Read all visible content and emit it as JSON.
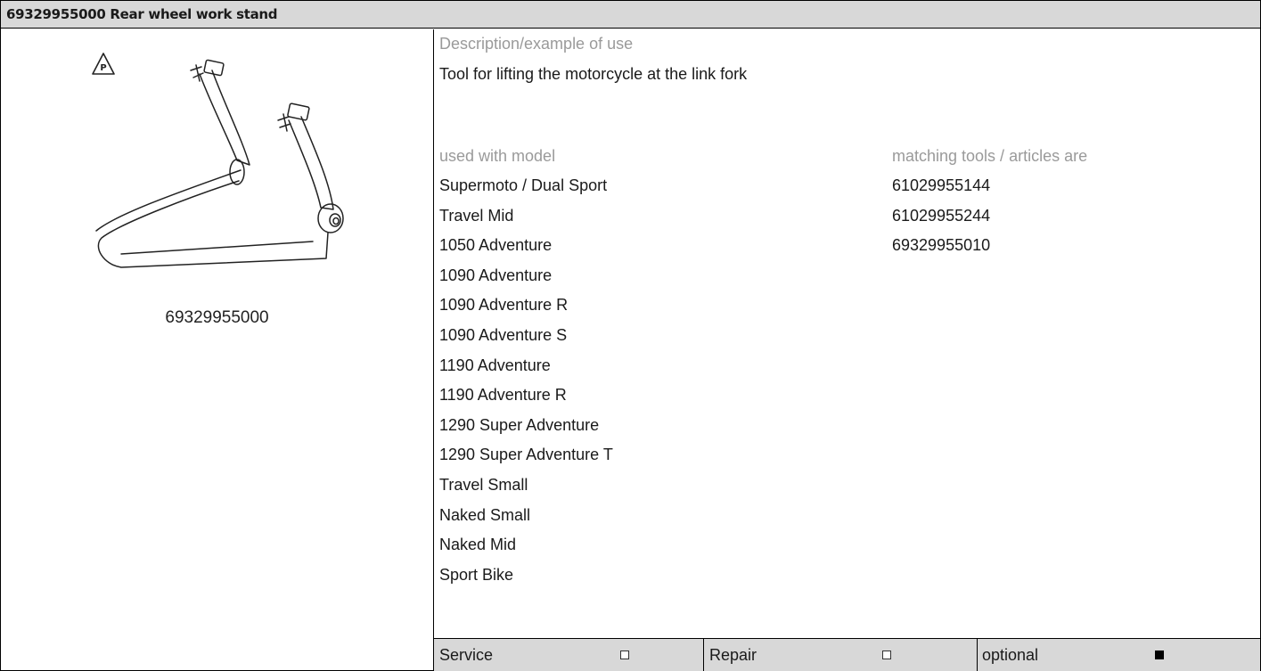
{
  "header": {
    "title": "69329955000 Rear wheel work stand"
  },
  "tool": {
    "image_icon": "rear-wheel-work-stand-drawing",
    "warning_icon": "p-warning-triangle-icon",
    "warning_letter": "P",
    "number": "69329955000"
  },
  "description": {
    "label": "Description/example of use",
    "text": "Tool for lifting the motorcycle at the link fork"
  },
  "models": {
    "label": "used with model",
    "items": [
      "Supermoto / Dual Sport",
      "Travel Mid",
      "1050 Adventure",
      "1090 Adventure",
      "1090 Adventure R",
      "1090 Adventure S",
      "1190 Adventure",
      "1190 Adventure R",
      "1290 Super Adventure",
      "1290 Super Adventure T",
      "Travel Small",
      "Naked Small",
      "Naked Mid",
      "Sport Bike"
    ]
  },
  "matching": {
    "label": "matching tools / articles are",
    "items": [
      "61029955144",
      "61029955244",
      "69329955010"
    ]
  },
  "footer": {
    "service_label": "Service",
    "service_checked": false,
    "repair_label": "Repair",
    "repair_checked": false,
    "optional_label": "optional",
    "optional_checked": true
  },
  "colors": {
    "header_bg": "#d8d8d8",
    "label_grey": "#9a9a9a",
    "border": "#000000"
  }
}
